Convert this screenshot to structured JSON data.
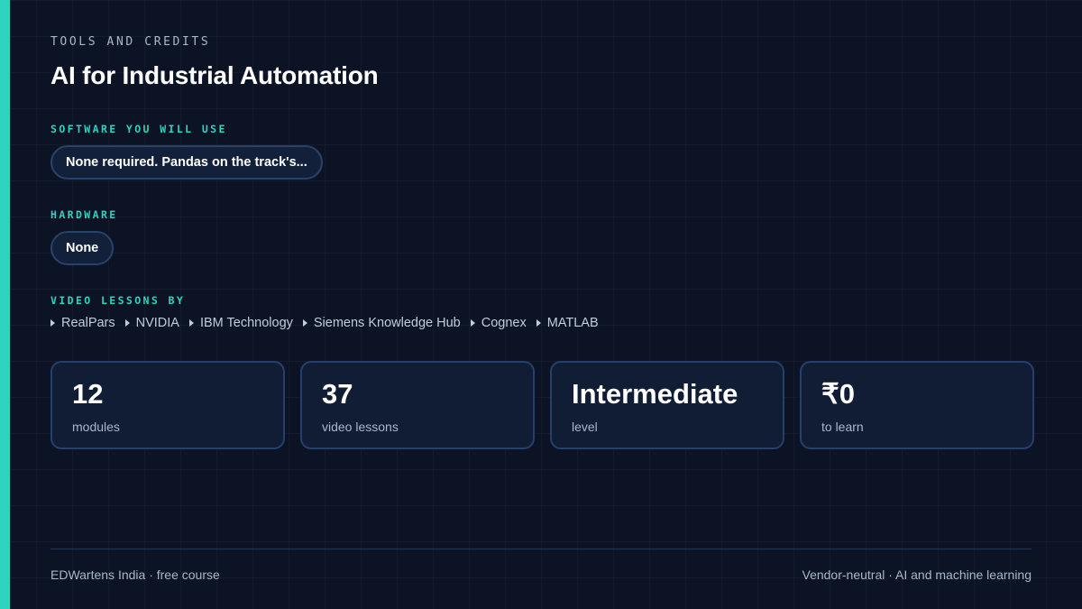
{
  "header": {
    "eyebrow": "TOOLS AND CREDITS",
    "title": "AI for Industrial Automation"
  },
  "software": {
    "label": "SOFTWARE YOU WILL USE",
    "value": "None required. Pandas on the track's..."
  },
  "hardware": {
    "label": "HARDWARE",
    "value": "None"
  },
  "videos": {
    "label": "VIDEO LESSONS BY",
    "providers": [
      "RealPars",
      "NVIDIA",
      "IBM Technology",
      "Siemens Knowledge Hub",
      "Cognex",
      "MATLAB"
    ]
  },
  "stats": [
    {
      "value": "12",
      "label": "modules"
    },
    {
      "value": "37",
      "label": "video lessons"
    },
    {
      "value": "Intermediate",
      "label": "level"
    },
    {
      "value": "₹0",
      "label": "to learn"
    }
  ],
  "footer": {
    "left": "EDWartens India · free course",
    "right": "Vendor-neutral · AI and machine learning"
  },
  "colors": {
    "accent": "#2dd4bf",
    "background": "#0b1325",
    "card_border": "#27406a"
  }
}
